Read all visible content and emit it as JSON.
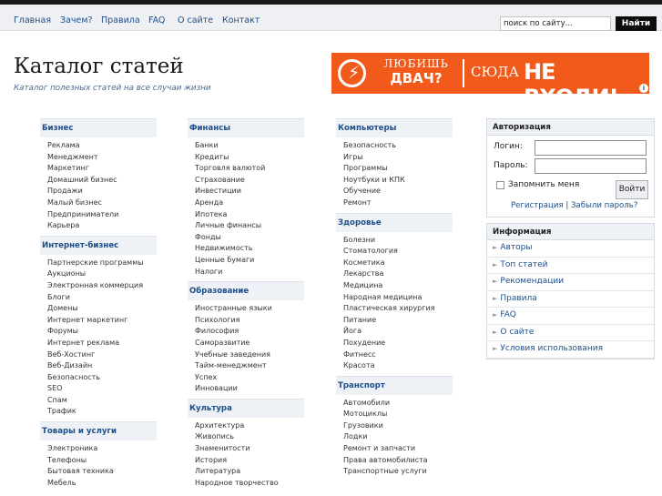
{
  "nav": {
    "items": [
      "Главная",
      "Зачем?",
      "Правила",
      "FAQ",
      "О сайте",
      "Контакт"
    ],
    "search_value": "поиск по сайту...",
    "search_button": "Найти"
  },
  "header": {
    "title": "Каталог статей",
    "subtitle": "Каталог полезных статей на все случаи жизни"
  },
  "banner": {
    "line1": "ЛЮБИШЬ",
    "line2": "ДВАЧ?",
    "line3": "СЮДА",
    "line4": "НЕ ВХОДИ!",
    "icon": "lightning-icon",
    "info_glyph": "i"
  },
  "columns": [
    [
      {
        "title": "Бизнес",
        "items": [
          "Реклама",
          "Менеджмент",
          "Маркетинг",
          "Домашний бизнес",
          "Продажи",
          "Малый бизнес",
          "Предприниматели",
          "Карьера"
        ]
      },
      {
        "title": "Интернет-бизнес",
        "items": [
          "Партнерские программы",
          "Аукционы",
          "Электронная коммерция",
          "Блоги",
          "Домены",
          "Интернет маркетинг",
          "Форумы",
          "Интернет реклама",
          "Веб-Хостинг",
          "Веб-Дизайн",
          "Безопасность",
          "SEO",
          "Спам",
          "Трафик"
        ]
      },
      {
        "title": "Товары и услуги",
        "items": [
          "Электроника",
          "Телефоны",
          "Бытовая техника",
          "Мебель"
        ]
      }
    ],
    [
      {
        "title": "Финансы",
        "items": [
          "Банки",
          "Кредиты",
          "Торговля валютой",
          "Страхование",
          "Инвестиции",
          "Аренда",
          "Ипотека",
          "Личные финансы",
          "Фонды",
          "Недвижимость",
          "Ценные бумаги",
          "Налоги"
        ]
      },
      {
        "title": "Образование",
        "items": [
          "Иностранные языки",
          "Психология",
          "Философия",
          "Саморазвитие",
          "Учебные заведения",
          "Тайм-менеджмент",
          "Успех",
          "Инновации"
        ]
      },
      {
        "title": "Культура",
        "items": [
          "Архитектура",
          "Живопись",
          "Знаменитости",
          "История",
          "Литература",
          "Народное творчество"
        ]
      }
    ],
    [
      {
        "title": "Компьютеры",
        "items": [
          "Безопасность",
          "Игры",
          "Программы",
          "Ноутбуки и КПК",
          "Обучение",
          "Ремонт"
        ]
      },
      {
        "title": "Здоровье",
        "items": [
          "Болезни",
          "Стоматология",
          "Косметика",
          "Лекарства",
          "Медицина",
          "Народная медицина",
          "Пластическая хирургия",
          "Питание",
          "Йога",
          "Похудение",
          "Фитнесс",
          "Красота"
        ]
      },
      {
        "title": "Транспорт",
        "items": [
          "Автомобили",
          "Мотоциклы",
          "Грузовики",
          "Лодки",
          "Ремонт и запчасти",
          "Права автомобилиста",
          "Транспортные услуги"
        ]
      }
    ]
  ],
  "auth": {
    "title": "Авторизация",
    "login_label": "Логин:",
    "password_label": "Пароль:",
    "remember_label": "Запомнить меня",
    "login_button": "Войти",
    "register_link": "Регистрация",
    "divider": "|",
    "forgot_link": "Забыли пароль?"
  },
  "info": {
    "title": "Информация",
    "items": [
      "Авторы",
      "Топ статей",
      "Рекомендации",
      "Правила",
      "FAQ",
      "О сайте",
      "Условия использования"
    ]
  }
}
